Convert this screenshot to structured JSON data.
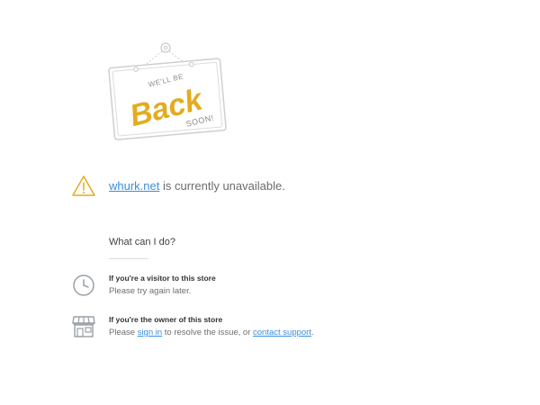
{
  "sign": {
    "line1": "WE'LL BE",
    "line2": "Back",
    "line3": "SOON!"
  },
  "status": {
    "domain": "whurk.net",
    "message": " is currently unavailable.",
    "icon": "warning-icon"
  },
  "help": {
    "title": "What can I do?",
    "visitor": {
      "title": "If you're a visitor to this store",
      "text": "Please try again later.",
      "icon": "clock-icon"
    },
    "owner": {
      "title": "If you're the owner of this store",
      "text_before": "Please ",
      "sign_in_link": "sign in",
      "text_middle": " to resolve the issue, or ",
      "contact_link": "contact support",
      "text_after": ".",
      "icon": "storefront-icon"
    }
  },
  "colors": {
    "accent": "#E3AC1E",
    "link": "#3A8ED8",
    "icon": "#9aa0a6"
  }
}
